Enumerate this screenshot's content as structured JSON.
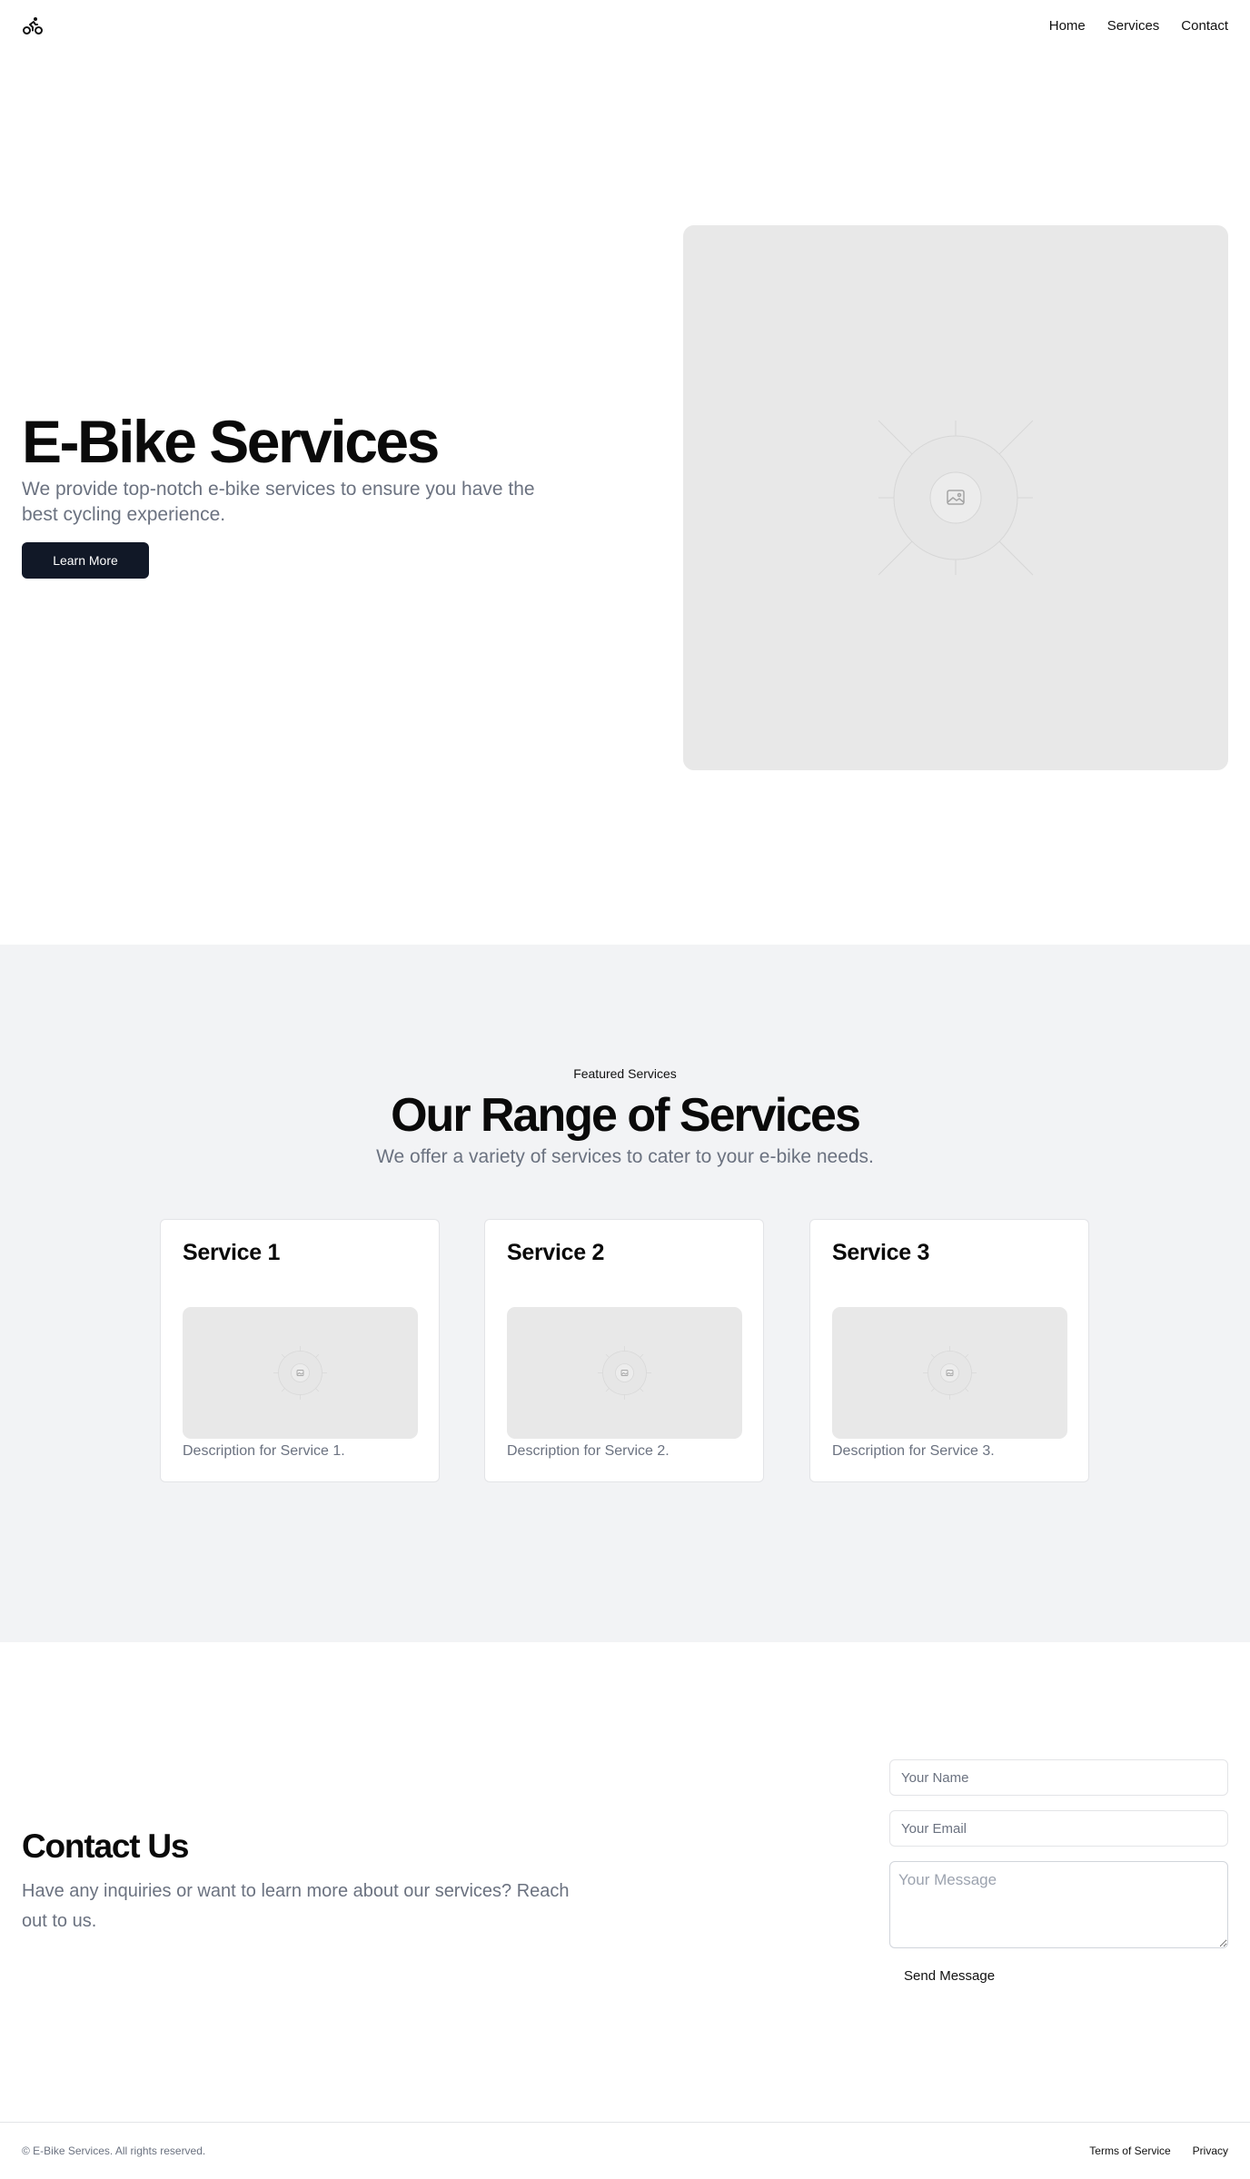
{
  "nav": {
    "logo_icon": "bike-icon",
    "links": [
      "Home",
      "Services",
      "Contact"
    ]
  },
  "hero": {
    "title": "E-Bike Services",
    "subtitle": "We provide top-notch e-bike services to ensure you have the best cycling experience.",
    "cta_label": "Learn More",
    "image_icon": "image-placeholder-icon"
  },
  "services": {
    "eyebrow": "Featured Services",
    "title": "Our Range of Services",
    "subtitle": "We offer a variety of services to cater to your e-bike needs.",
    "cards": [
      {
        "title": "Service 1",
        "description": "Description for Service 1."
      },
      {
        "title": "Service 2",
        "description": "Description for Service 2."
      },
      {
        "title": "Service 3",
        "description": "Description for Service 3."
      }
    ]
  },
  "contact": {
    "title": "Contact Us",
    "subtitle": "Have any inquiries or want to learn more about our services? Reach out to us.",
    "name_placeholder": "Your Name",
    "email_placeholder": "Your Email",
    "message_placeholder": "Your Message",
    "send_label": "Send Message"
  },
  "footer": {
    "copyright": "© E-Bike Services. All rights reserved.",
    "links": [
      "Terms of Service",
      "Privacy"
    ]
  },
  "colors": {
    "primary_button": "#111827",
    "muted_text": "#6b7280",
    "section_background": "#f2f3f5",
    "placeholder_background": "#e8e8e8"
  }
}
